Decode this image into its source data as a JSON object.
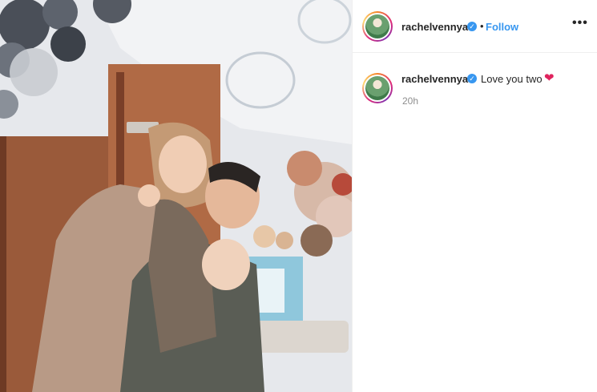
{
  "header": {
    "username": "rachelvennya",
    "separator": "•",
    "follow_label": "Follow",
    "more_label": "•••",
    "verified_icon": "verified-badge-icon"
  },
  "comment": {
    "username": "rachelvennya",
    "text": "Love you two",
    "heart_icon": "❤",
    "timestamp": "20h"
  },
  "colors": {
    "link_blue": "#3897f0",
    "verified_blue": "#3897f0",
    "text_dark": "#262626",
    "text_muted": "#8e8e8e",
    "heart_red": "#e0245e"
  }
}
